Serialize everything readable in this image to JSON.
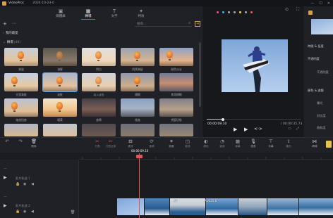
{
  "app": {
    "name": "VideoProc",
    "project": "2024-10-23-0"
  },
  "window_controls": [
    "—",
    "☐",
    "✕"
  ],
  "tabs": [
    {
      "label": "媒體庫",
      "icon": "▣"
    },
    {
      "label": "轉場",
      "icon": "▦"
    },
    {
      "label": "文字",
      "icon": "T"
    },
    {
      "label": "特效",
      "icon": "✦"
    }
  ],
  "search": {
    "placeholder": "搜尋..."
  },
  "sections": {
    "favorites": "我的最愛",
    "transitions": "轉場",
    "transitions_count": "(48)"
  },
  "tiles": [
    {
      "label": "漸變"
    },
    {
      "label": "溶解"
    },
    {
      "label": "閃白"
    },
    {
      "label": "閃黑漸變"
    },
    {
      "label": "顏色淡淡"
    },
    {
      "label": "光暈漸變"
    },
    {
      "label": "波紋"
    },
    {
      "label": "淡入淡出"
    },
    {
      "label": "模糊"
    },
    {
      "label": "焦距模糊"
    },
    {
      "label": "縮放扭曲"
    },
    {
      "label": "暖黃"
    },
    {
      "label": "旋轉"
    },
    {
      "label": "推進"
    },
    {
      "label": "視窗切換"
    },
    {
      "label": ""
    },
    {
      "label": ""
    },
    {
      "label": ""
    },
    {
      "label": ""
    },
    {
      "label": ""
    }
  ],
  "preview": {
    "time": "00:00:09.10",
    "total": "/ 00:00:35.73",
    "duration": "00:00:35.73"
  },
  "right_panel": {
    "items": [
      "時間 & 長度",
      "不透明度",
      "不透明度",
      "顏色 & 濾鏡",
      "曝光",
      "對比度",
      "飽和度"
    ]
  },
  "edit_tools": [
    "刪除",
    "分割",
    "分割全部",
    "拆分",
    "旋轉",
    "剪裁",
    "動態",
    "調色",
    "變速",
    "綠幕",
    "語音",
    "字幕",
    "匯出",
    "轉場"
  ],
  "timeline": {
    "playhead_time": "00:00:09.10",
    "track1": "影片軌道 1",
    "track2": "影片軌道 2",
    "clip_labels": [
      "AR",
      "AUS25 Ei"
    ]
  }
}
